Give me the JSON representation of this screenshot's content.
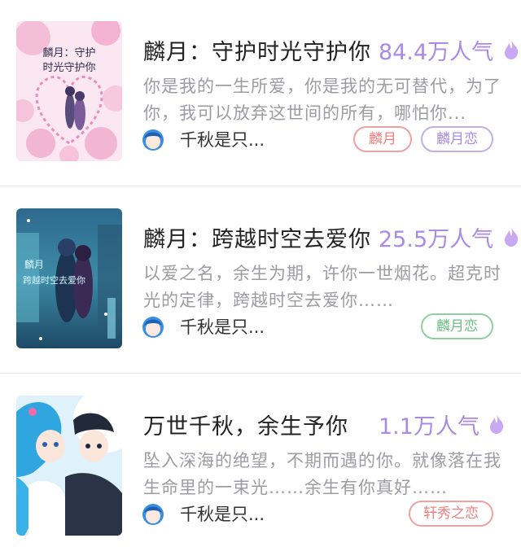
{
  "books": [
    {
      "cover_text": [
        "麟月：守护",
        "时光守护你"
      ],
      "title": "麟月：守护时光守护你",
      "popularity": "84.4万人气",
      "description": "你是我的一生所爱，你是我的无可替代，为了你，我可以放弃这世间的所有，哪怕你...",
      "author": "千秋是只...",
      "tags": [
        "麟月",
        "麟月恋"
      ]
    },
    {
      "cover_text": [
        "麟月",
        "跨越时空去爱你"
      ],
      "title": "麟月：跨越时空去爱你",
      "popularity": "25.5万人气",
      "description": "以爱之名，余生为期，许你一世烟花。超克时光的定律，跨越时空去爱你……",
      "author": "千秋是只...",
      "tags": [
        "麟月恋"
      ]
    },
    {
      "title": "万世千秋，余生予你",
      "popularity": "1.1万人气",
      "description": "坠入深海的绝望，不期而遇的你。就像落在我生命里的一束光……余生有你真好……",
      "author": "千秋是只...",
      "tags": [
        "轩秀之恋"
      ]
    }
  ],
  "icons": {
    "popularity": "flame-icon",
    "author": "author-avatar"
  },
  "colors": {
    "popularity_text": "#a98be6",
    "flame": "#c9a8f3",
    "tag_red": "#ef7f7f",
    "tag_purple": "#a88ae3",
    "tag_green": "#6fbe86"
  }
}
